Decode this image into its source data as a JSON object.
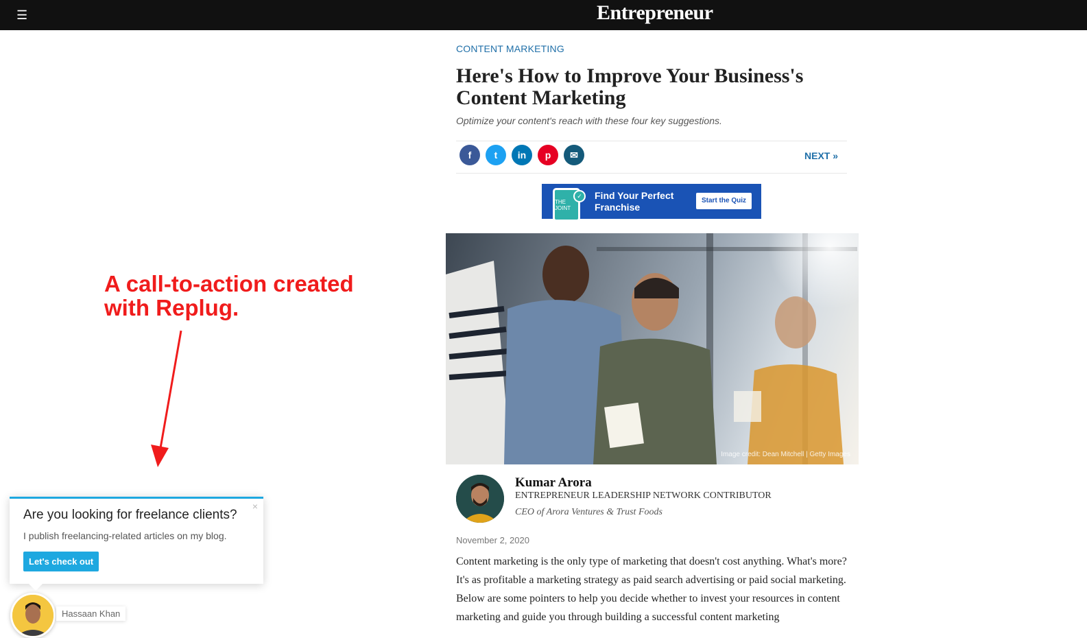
{
  "header": {
    "menu_icon": "hamburger-icon",
    "logo": "Entrepreneur"
  },
  "article": {
    "category": "CONTENT MARKETING",
    "title": "Here's How to Improve Your Business's Content Marketing",
    "subtitle": "Optimize your content's reach with these four key suggestions.",
    "share": [
      {
        "icon": "facebook-icon",
        "glyph": "f",
        "color": "#3b5998"
      },
      {
        "icon": "twitter-icon",
        "glyph": "t",
        "color": "#1da1f2"
      },
      {
        "icon": "linkedin-icon",
        "glyph": "in",
        "color": "#0077b5"
      },
      {
        "icon": "pinterest-icon",
        "glyph": "p",
        "color": "#e60023"
      },
      {
        "icon": "email-icon",
        "glyph": "✉",
        "color": "#145a7a"
      }
    ],
    "next_label": "NEXT »",
    "ad": {
      "brand": "The Joint chiropractic",
      "headline": "Find Your Perfect Franchise",
      "button": "Start the Quiz"
    },
    "image_credit": "Image credit: Dean Mitchell | Getty Images",
    "author": {
      "name": "Kumar Arora",
      "role": "ENTREPRENEUR LEADERSHIP NETWORK CONTRIBUTOR",
      "bio": "CEO of Arora Ventures & Trust Foods"
    },
    "date": "November 2, 2020",
    "body": "Content marketing is the only type of marketing that doesn't cost anything. What's more? It's as profitable a marketing strategy as paid search advertising or paid social marketing. Below are some pointers to help you decide whether to invest your resources in content marketing and guide you through building a successful content marketing"
  },
  "annotation": {
    "text": "A call-to-action created with Replug."
  },
  "cta": {
    "title": "Are you looking for freelance clients?",
    "text": "I publish freelancing-related articles on my blog.",
    "button": "Let's check out",
    "close": "×",
    "user_name": "Hassaan Khan"
  },
  "colors": {
    "link": "#1f6fa8",
    "annotation": "#f01c1c",
    "cta_accent": "#1ea8e0",
    "ad_bg": "#1a53b5"
  }
}
